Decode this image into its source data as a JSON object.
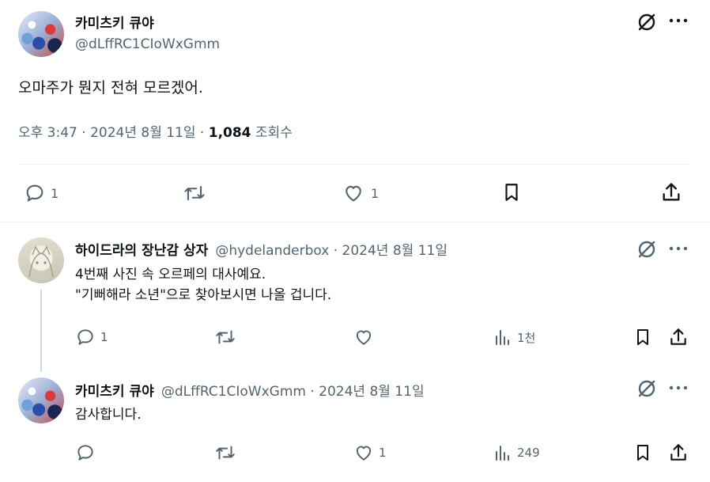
{
  "main_tweet": {
    "author_name": "카미츠키 큐야",
    "author_handle": "@dLffRC1CIoWxGmm",
    "text": "오마주가 뭔지 전혀 모르겠어.",
    "time": "오후 3:47 · 2024년 8월 11일 · ",
    "views_count": "1,084",
    "views_label": " 조회수",
    "actions": {
      "replies": "1",
      "retweets": "",
      "likes": "1"
    }
  },
  "replies": [
    {
      "author_name": "하이드라의 장난감 상자",
      "author_handle": "@hydelanderbox · 2024년 8월 11일",
      "lines": [
        "4번째 사진 속 오르페의 대사예요.",
        "\"기뻐해라 소년\"으로 찾아보시면 나올 겁니다."
      ],
      "actions": {
        "replies": "1",
        "retweets": "",
        "likes": "",
        "views": "1천"
      }
    },
    {
      "author_name": "카미츠키 큐야",
      "author_handle": "@dLffRC1CIoWxGmm · 2024년 8월 11일",
      "lines": [
        "감사합니다."
      ],
      "actions": {
        "replies": "",
        "retweets": "",
        "likes": "1",
        "views": "249"
      }
    }
  ],
  "colors": {
    "text": "#0f1419",
    "muted": "#536471",
    "divider": "#eff3f4",
    "thread": "#cfd9de"
  },
  "icons": [
    "grok-icon",
    "more-icon",
    "reply-icon",
    "retweet-icon",
    "like-icon",
    "views-icon",
    "bookmark-icon",
    "share-icon"
  ]
}
